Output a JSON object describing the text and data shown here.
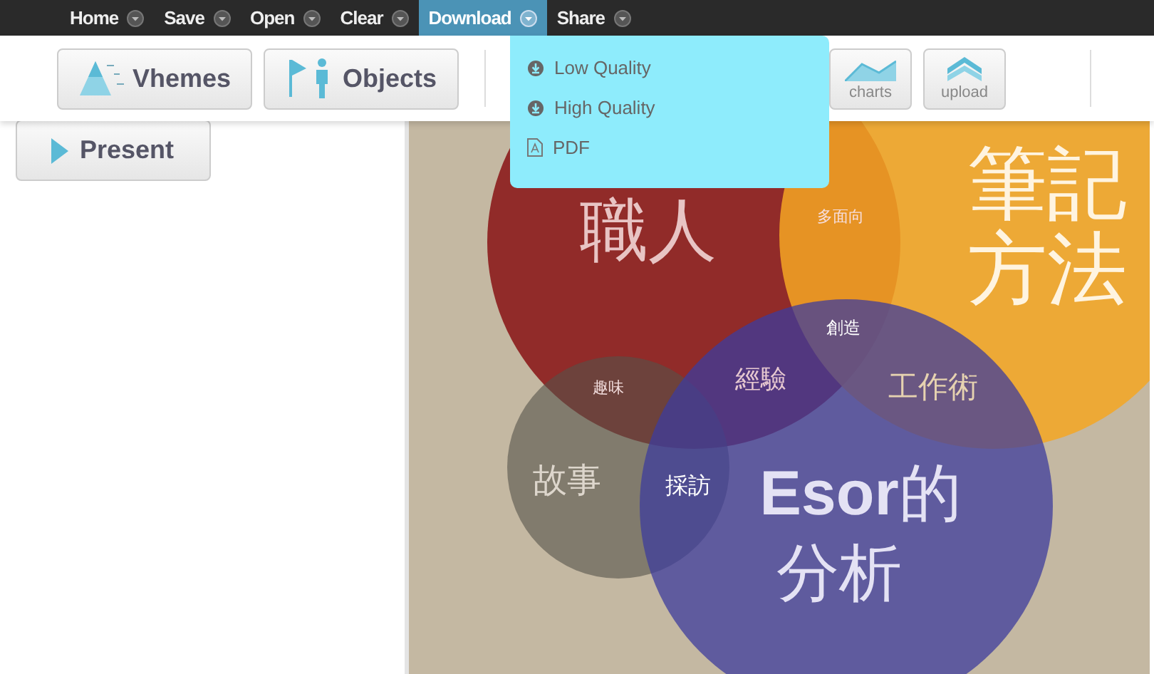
{
  "menu": [
    {
      "label": "Home",
      "selected": false
    },
    {
      "label": "Save",
      "selected": false
    },
    {
      "label": "Open",
      "selected": false
    },
    {
      "label": "Clear",
      "selected": false
    },
    {
      "label": "Download",
      "selected": true
    },
    {
      "label": "Share",
      "selected": false
    }
  ],
  "toolbar": {
    "left_buttons": [
      {
        "label": "Vhemes",
        "kind": "themes"
      },
      {
        "label": "Objects",
        "kind": "objects"
      }
    ],
    "right_buttons": [
      {
        "label": "charts",
        "kind": "charts"
      },
      {
        "label": "upload",
        "kind": "upload"
      }
    ]
  },
  "dropdown": {
    "items": [
      {
        "label": "Low Quality",
        "kind": "download"
      },
      {
        "label": "High Quality",
        "kind": "download"
      },
      {
        "label": "PDF",
        "kind": "pdf"
      }
    ]
  },
  "sidebar": {
    "present_button": "Present"
  },
  "canvas": {
    "labels": [
      "筆記",
      "多面向",
      "職人",
      "方法",
      "創造",
      "趣味",
      "經驗",
      "工作術",
      "故事",
      "採訪",
      "**Esor**的",
      "分析"
    ]
  }
}
